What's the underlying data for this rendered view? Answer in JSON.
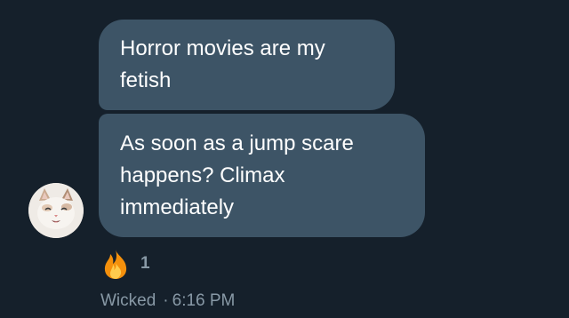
{
  "messages": [
    {
      "lines": [
        "Horror movies are my",
        "fetish"
      ]
    },
    {
      "lines": [
        "As soon as a jump scare",
        "happens? Climax",
        "immediately"
      ]
    }
  ],
  "reaction": {
    "icon": "fire-emoji-icon",
    "count": "1"
  },
  "meta": {
    "sender": "Wicked",
    "separator": "·",
    "time": "6:16 PM"
  },
  "colors": {
    "background": "#15202b",
    "bubble": "#3d5466",
    "text": "#ffffff",
    "muted": "#8899a6"
  }
}
